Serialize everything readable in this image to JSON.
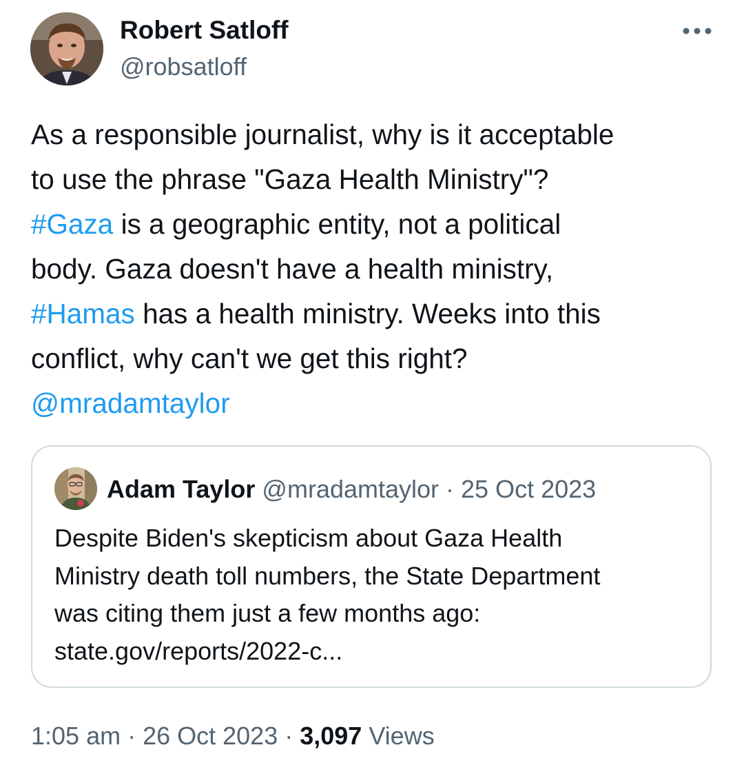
{
  "author": {
    "name": "Robert Satloff",
    "handle": "@robsatloff"
  },
  "more_icon": "more-horizontal-icon",
  "tweet": {
    "segments": [
      {
        "text": "As a responsible journalist, why is it acceptable\nto use the phrase \"Gaza Health Ministry\"?\n",
        "kind": "text"
      },
      {
        "text": "#Gaza",
        "kind": "hashtag"
      },
      {
        "text": " is a geographic entity, not a political\nbody. Gaza doesn't have a health ministry,\n",
        "kind": "text"
      },
      {
        "text": "#Hamas",
        "kind": "hashtag"
      },
      {
        "text": " has a health ministry. Weeks into this\nconflict, why can't we get this right?\n",
        "kind": "text"
      },
      {
        "text": "@mradamtaylor",
        "kind": "mention"
      }
    ]
  },
  "quote": {
    "name": "Adam Taylor",
    "handle": "@mradamtaylor",
    "separator": " · ",
    "date": "25 Oct 2023",
    "text": "Despite Biden's skepticism about Gaza Health\nMinistry death toll numbers, the State Department\nwas citing them just a few months ago:\nstate.gov/reports/2022-c..."
  },
  "footer": {
    "time": "1:05 am",
    "separator": " · ",
    "date": "26 Oct 2023",
    "separator2": " · ",
    "views_count": "3,097",
    "views_label": " Views"
  },
  "colors": {
    "link": "#1d9bf0",
    "secondary_text": "#536471",
    "primary_text": "#0f1419",
    "border": "#cfd9de"
  }
}
